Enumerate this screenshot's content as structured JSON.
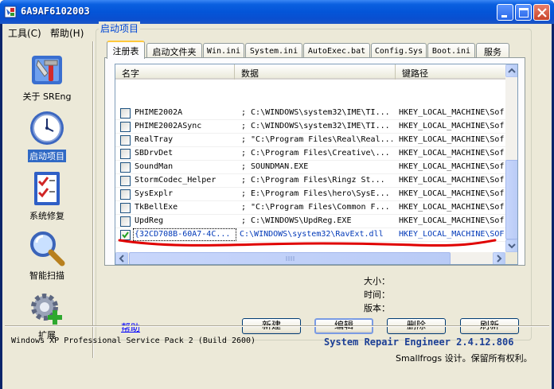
{
  "window": {
    "title": "6A9AF6102003"
  },
  "menu": [
    {
      "label": "工具(C)"
    },
    {
      "label": "帮助(H)"
    }
  ],
  "sidebar": {
    "items": [
      {
        "label": "关于 SREng",
        "icon": "tools-icon",
        "active": false
      },
      {
        "label": "启动项目",
        "icon": "clock-icon",
        "active": true
      },
      {
        "label": "系统修复",
        "icon": "checklist-icon",
        "active": false
      },
      {
        "label": "智能扫描",
        "icon": "magnifier-icon",
        "active": false
      },
      {
        "label": "扩展",
        "icon": "gear-plus-icon",
        "active": false
      }
    ]
  },
  "group": {
    "title": "启动项目"
  },
  "tabs": [
    {
      "label": "注册表",
      "active": true
    },
    {
      "label": "启动文件夹",
      "active": false
    },
    {
      "label": "Win.ini",
      "active": false
    },
    {
      "label": "System.ini",
      "active": false
    },
    {
      "label": "AutoExec.bat",
      "active": false
    },
    {
      "label": "Config.Sys",
      "active": false
    },
    {
      "label": "Boot.ini",
      "active": false
    },
    {
      "label": "服务",
      "active": false
    }
  ],
  "list": {
    "columns": [
      "名字",
      "数据",
      "键路径"
    ],
    "rows": [
      {
        "name": "PHIME2002A",
        "data": "; C:\\WINDOWS\\system32\\IME\\TI...",
        "path": "HKEY_LOCAL_MACHINE\\Sof",
        "checked": false
      },
      {
        "name": "PHIME2002ASync",
        "data": "; C:\\WINDOWS\\system32\\IME\\TI...",
        "path": "HKEY_LOCAL_MACHINE\\Sof",
        "checked": false
      },
      {
        "name": "RealTray",
        "data": "; \"C:\\Program Files\\Real\\Real...",
        "path": "HKEY_LOCAL_MACHINE\\Sof",
        "checked": false
      },
      {
        "name": "SBDrvDet",
        "data": "; C:\\Program Files\\Creative\\...",
        "path": "HKEY_LOCAL_MACHINE\\Sof",
        "checked": false
      },
      {
        "name": "SoundMan",
        "data": "; SOUNDMAN.EXE",
        "path": "HKEY_LOCAL_MACHINE\\Sof",
        "checked": false
      },
      {
        "name": "StormCodec_Helper",
        "data": "; C:\\Program Files\\Ringz St...",
        "path": "HKEY_LOCAL_MACHINE\\Sof",
        "checked": false
      },
      {
        "name": "SysExplr",
        "data": "; E:\\Program Files\\hero\\SysE...",
        "path": "HKEY_LOCAL_MACHINE\\Sof",
        "checked": false
      },
      {
        "name": "TkBellExe",
        "data": "; \"C:\\Program Files\\Common F...",
        "path": "HKEY_LOCAL_MACHINE\\Sof",
        "checked": false
      },
      {
        "name": "UpdReg",
        "data": "; C:\\WINDOWS\\UpdReg.EXE",
        "path": "HKEY_LOCAL_MACHINE\\Sof",
        "checked": false
      },
      {
        "name": "{32CD708B-60A7-4C...",
        "data": "C:\\WINDOWS\\system32\\RavExt.dll",
        "path": "HKEY_LOCAL_MACHINE\\SOF",
        "checked": true,
        "selected": true
      }
    ]
  },
  "details": {
    "size_label": "大小：",
    "time_label": "时间：",
    "version_label": "版本："
  },
  "actions": {
    "help": "帮助",
    "new": "新建",
    "edit": "编辑",
    "delete": "删除",
    "refresh": "刷新"
  },
  "status": {
    "os": "Windows XP Professional Service Pack 2 (Build 2600)",
    "product": "System Repair Engineer 2.4.12.806",
    "copyright": "Smallfrogs 设计。保留所有权利。"
  },
  "colors": {
    "titlebar": "#0455d8",
    "annotation": "#e00000",
    "link": "#0000ff"
  }
}
